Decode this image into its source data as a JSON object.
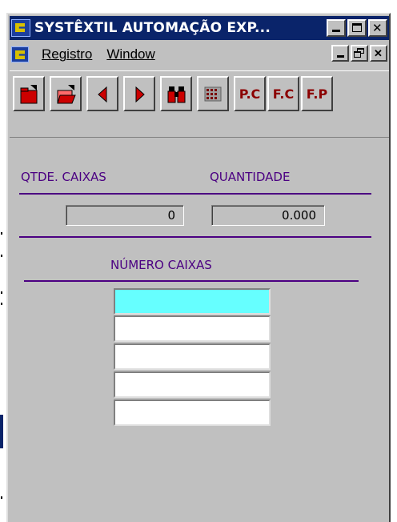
{
  "window": {
    "title": "SYSTÊXTIL AUTOMAÇÃO EXP...",
    "caption_buttons": [
      "minimize",
      "maximize",
      "close"
    ]
  },
  "menubar": {
    "items": [
      "Registro",
      "Window"
    ],
    "mdi_buttons": [
      "minimize",
      "restore",
      "close"
    ]
  },
  "toolbar": {
    "buttons": [
      {
        "name": "new-record",
        "icon": "folder-red-icon"
      },
      {
        "name": "open-record",
        "icon": "folder-open-icon"
      },
      {
        "name": "previous",
        "icon": "arrow-left-icon"
      },
      {
        "name": "next",
        "icon": "arrow-right-icon"
      },
      {
        "name": "search",
        "icon": "binoculars-icon"
      },
      {
        "name": "grid",
        "icon": "keyboard-grid-icon"
      },
      {
        "name": "pc",
        "label": "P.C"
      },
      {
        "name": "fc",
        "label": "F.C"
      },
      {
        "name": "fp",
        "label": "F.P"
      }
    ]
  },
  "form": {
    "qtde_caixas_label": "QTDE. CAIXAS",
    "quantidade_label": "QUANTIDADE",
    "qtde_caixas_value": "0",
    "quantidade_value": "0.000",
    "numero_caixas_label": "NÚMERO CAIXAS",
    "numero_caixas_rows": [
      "",
      "",
      "",
      "",
      ""
    ]
  },
  "colors": {
    "title_bar": "#0a246a",
    "label_text": "#4b0082",
    "active_field": "#66ffff",
    "toolbar_text": "#8b0000"
  }
}
